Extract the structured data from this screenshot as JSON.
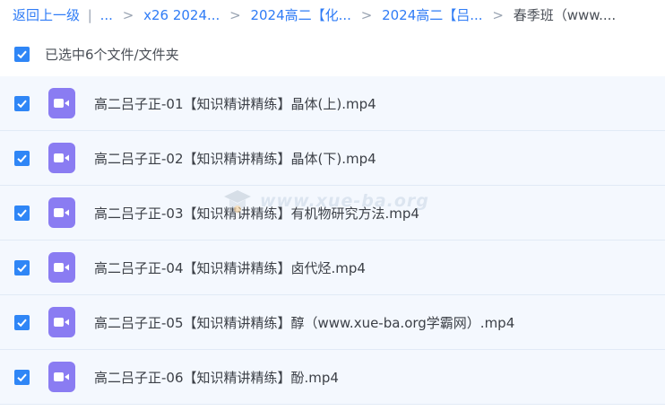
{
  "breadcrumb": {
    "back": "返回上一级",
    "sep": "|",
    "ellipsis": "...",
    "crumbs": [
      "x26 2024...",
      "2024高二【化...",
      "2024高二【吕..."
    ],
    "current": "春季班（www...."
  },
  "selection": {
    "label": "已选中6个文件/文件夹",
    "checked": true
  },
  "files": [
    {
      "name": "高二吕子正-01【知识精讲精练】晶体(上).mp4",
      "checked": true,
      "icon": "video-icon"
    },
    {
      "name": "高二吕子正-02【知识精讲精练】晶体(下).mp4",
      "checked": true,
      "icon": "video-icon"
    },
    {
      "name": "高二吕子正-03【知识精讲精练】有机物研究方法.mp4",
      "checked": true,
      "icon": "video-icon"
    },
    {
      "name": "高二吕子正-04【知识精讲精练】卤代烃.mp4",
      "checked": true,
      "icon": "video-icon"
    },
    {
      "name": "高二吕子正-05【知识精讲精练】醇（www.xue-ba.org学霸网）.mp4",
      "checked": true,
      "icon": "video-icon"
    },
    {
      "name": "高二吕子正-06【知识精讲精练】酚.mp4",
      "checked": true,
      "icon": "video-icon"
    }
  ],
  "watermark": {
    "text": "www.xue-ba.org"
  },
  "colors": {
    "accent": "#2f86f6",
    "link": "#2f7cf6",
    "row_bg": "#f4f8fe",
    "video_icon": "#8a7cf2"
  }
}
